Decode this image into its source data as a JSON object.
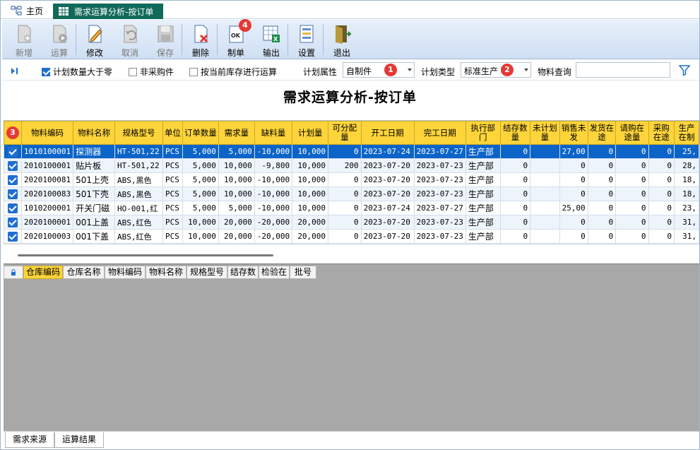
{
  "tabs": {
    "home": "主页",
    "active": "需求运算分析-按订单"
  },
  "toolbar": [
    {
      "label": "新增",
      "icon": "new-doc-icon",
      "enabled": false
    },
    {
      "label": "运算",
      "icon": "run-icon",
      "enabled": false
    },
    {
      "label": "修改",
      "icon": "edit-icon",
      "enabled": true
    },
    {
      "label": "取消",
      "icon": "undo-icon",
      "enabled": false
    },
    {
      "label": "保存",
      "icon": "save-icon",
      "enabled": false
    },
    {
      "label": "删除",
      "icon": "delete-doc-icon",
      "enabled": true
    },
    {
      "label": "制单",
      "icon": "ok-doc-icon",
      "enabled": true,
      "badge": "4"
    },
    {
      "label": "输出",
      "icon": "export-excel-icon",
      "enabled": true
    },
    {
      "label": "设置",
      "icon": "settings-icon",
      "enabled": true
    },
    {
      "label": "退出",
      "icon": "exit-door-icon",
      "enabled": true
    }
  ],
  "options": {
    "chk_plan_gt_zero": "计划数量大于零",
    "chk_non_purchase": "非采购件",
    "chk_by_stock": "按当前库存进行运算",
    "plan_attr_label": "计划属性",
    "plan_attr_value": "自制件",
    "plan_attr_badge": "1",
    "plan_type_label": "计划类型",
    "plan_type_value": "标准生产",
    "plan_type_badge": "2",
    "material_query_label": "物料查询",
    "material_query_value": ""
  },
  "page_title": "需求运算分析-按订单",
  "grid": {
    "header_badge": "3",
    "columns": [
      "物料编码",
      "物料名称",
      "规格型号",
      "单位",
      "订单数量",
      "需求量",
      "缺料量",
      "计划量",
      "可分配量",
      "开工日期",
      "完工日期",
      "执行部门",
      "结存数量",
      "未计划量",
      "销售未发",
      "发货在途",
      "请购在途量",
      "采购在途",
      "生产在制"
    ],
    "rows": [
      [
        "1010100001",
        "探测器",
        "HT-501,22",
        "PCS",
        "5,000",
        "5,000",
        "-10,000",
        "10,000",
        "0",
        "2023-07-24",
        "2023-07-27",
        "生产部",
        "0",
        "",
        "27,00",
        "0",
        "0",
        "0",
        "25,"
      ],
      [
        "2010100001",
        "贴片板",
        "HT-501,22",
        "PCS",
        "5,000",
        "10,000",
        "-9,800",
        "10,000",
        "200",
        "2023-07-20",
        "2023-07-23",
        "生产部",
        "0",
        "",
        "0",
        "0",
        "0",
        "0",
        "28,"
      ],
      [
        "2020100081",
        "501上壳",
        "ABS,黑色",
        "PCS",
        "5,000",
        "10,000",
        "-10,000",
        "10,000",
        "0",
        "2023-07-20",
        "2023-07-23",
        "生产部",
        "0",
        "",
        "0",
        "0",
        "0",
        "0",
        "18,"
      ],
      [
        "2020100083",
        "501下壳",
        "ABS,黑色",
        "PCS",
        "5,000",
        "10,000",
        "-10,000",
        "10,000",
        "0",
        "2023-07-20",
        "2023-07-23",
        "生产部",
        "0",
        "",
        "0",
        "0",
        "0",
        "0",
        "18,"
      ],
      [
        "1010200001",
        "开关门磁",
        "HO-001,红",
        "PCS",
        "5,000",
        "5,000",
        "-10,000",
        "10,000",
        "0",
        "2023-07-24",
        "2023-07-27",
        "生产部",
        "0",
        "",
        "25,00",
        "0",
        "0",
        "0",
        "23,"
      ],
      [
        "2020100001",
        "001上盖",
        "ABS,红色",
        "PCS",
        "10,000",
        "20,000",
        "-20,000",
        "20,000",
        "0",
        "2023-07-20",
        "2023-07-23",
        "生产部",
        "0",
        "",
        "0",
        "0",
        "0",
        "0",
        "31,"
      ],
      [
        "2020100003",
        "001下盖",
        "ABS,红色",
        "PCS",
        "10,000",
        "20,000",
        "-20,000",
        "20,000",
        "0",
        "2023-07-20",
        "2023-07-23",
        "生产部",
        "0",
        "",
        "0",
        "0",
        "0",
        "0",
        "31,"
      ]
    ]
  },
  "lower_grid": {
    "columns": [
      "仓库编码",
      "仓库名称",
      "物料编码",
      "物料名称",
      "规格型号",
      "结存数",
      "检验在",
      "批号"
    ]
  },
  "bottom_tabs": [
    "需求来源",
    "运算结果"
  ]
}
